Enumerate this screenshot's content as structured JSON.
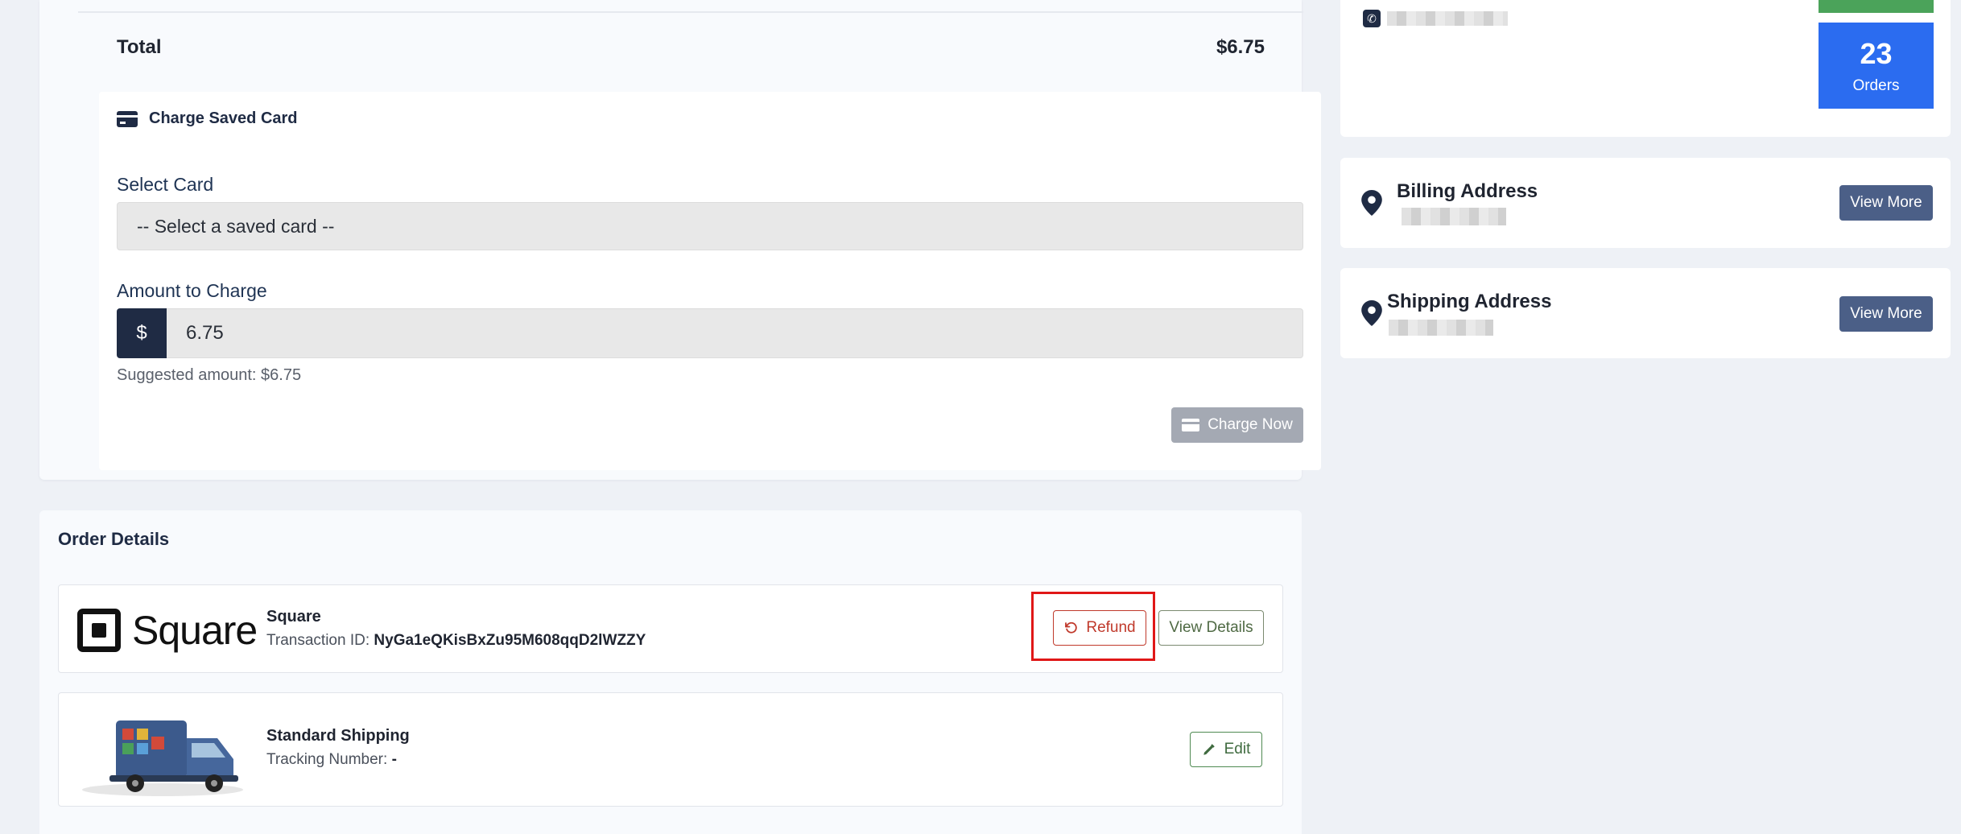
{
  "summary": {
    "total_label": "Total",
    "total_value": "$6.75"
  },
  "charge": {
    "title": "Charge Saved Card",
    "select_label": "Select Card",
    "select_value": "-- Select a saved card --",
    "amount_label": "Amount to Charge",
    "currency_symbol": "$",
    "amount_value": "6.75",
    "hint": "Suggested amount: $6.75",
    "button_label": "Charge Now"
  },
  "order_details": {
    "title": "Order Details",
    "payment": {
      "logo_text": "Square",
      "name": "Square",
      "transaction_label": "Transaction ID:",
      "transaction_id": "NyGa1eQKisBxZu95M608qqD2lWZZY",
      "refund_label": "Refund",
      "view_label": "View Details"
    },
    "shipping": {
      "name": "Standard Shipping",
      "tracking_label": "Tracking Number:",
      "tracking_value": "-",
      "edit_label": "Edit"
    }
  },
  "customer": {
    "orders_count": "23",
    "orders_label": "Orders"
  },
  "addresses": {
    "billing_title": "Billing Address",
    "shipping_title": "Shipping Address",
    "view_more_label": "View More"
  },
  "colors": {
    "navy": "#1f2b44",
    "orders_blue": "#2b6cf0",
    "success_green": "#4ba35a",
    "refund_red": "#c0392b",
    "highlight_red": "#e01717"
  }
}
